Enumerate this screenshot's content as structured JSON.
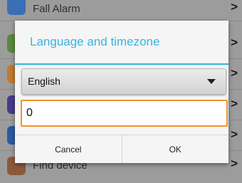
{
  "background": {
    "items": [
      {
        "label": "Fall Alarm",
        "icon": "fall-alarm-icon",
        "color": "#3b6fb5",
        "chevron": ">"
      },
      {
        "label": "",
        "icon": "contact-icon",
        "color": "#5a8a3a",
        "chevron": ">"
      },
      {
        "label": "",
        "icon": "phone-icon",
        "color": "#c07a30",
        "chevron": ">"
      },
      {
        "label": "",
        "icon": "moon-icon",
        "color": "#4a3a8a",
        "chevron": ">"
      },
      {
        "label": "",
        "icon": "location-icon",
        "color": "#2a5aa0",
        "chevron": ">"
      },
      {
        "label": "Find device",
        "icon": "watch-icon",
        "color": "#8a5a3a",
        "chevron": ">"
      }
    ]
  },
  "dialog": {
    "title": "Language and timezone",
    "language": {
      "selected": "English"
    },
    "timezone": {
      "value": "0"
    },
    "cancel_label": "Cancel",
    "ok_label": "OK"
  },
  "colors": {
    "accent": "#35b4e0",
    "focus": "#f0922c"
  }
}
